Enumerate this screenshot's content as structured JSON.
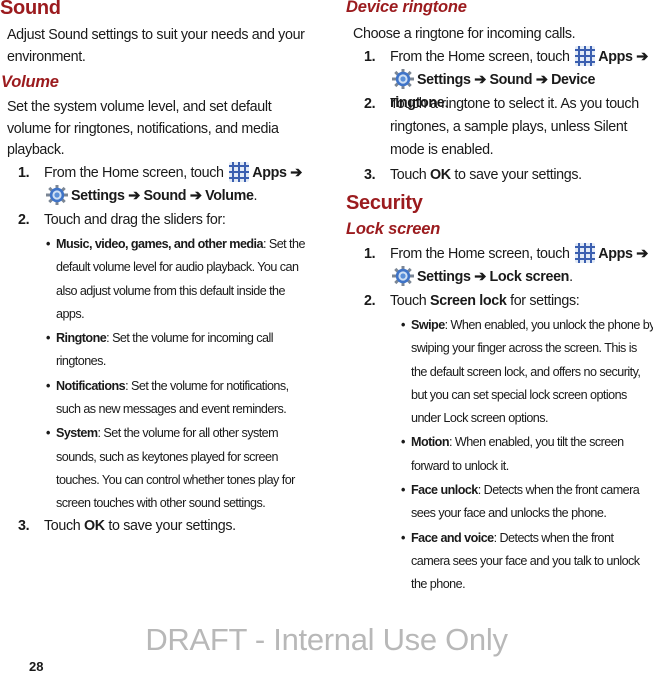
{
  "page_number": "28",
  "watermark": "DRAFT - Internal Use Only",
  "sound": {
    "title": "Sound",
    "intro": "Adjust Sound settings to suit your needs and your environment.",
    "volume": {
      "title": "Volume",
      "intro": "Set the system volume level, and set default volume for ringtones, notifications, and media playback.",
      "steps": [
        {
          "num": "1.",
          "pre": "From the Home screen, touch",
          "apps": "Apps",
          "arrow": "➔",
          "settings": "Settings ➔ Sound ➔ Volume",
          "end": "."
        },
        {
          "num": "2.",
          "text": "Touch and drag the sliders for:"
        },
        {
          "num": "3.",
          "pre": "Touch",
          "bold": "OK",
          "post": "to save your settings."
        }
      ],
      "bullets": [
        {
          "term": "Music, video, games, and other media",
          "desc": ": Set the default volume level for audio playback. You can also adjust volume from this default inside the apps."
        },
        {
          "term": "Ringtone",
          "desc": ": Set the volume for incoming call ringtones."
        },
        {
          "term": "Notifications",
          "desc": ": Set the volume for notifications, such as new messages and event reminders."
        },
        {
          "term": "System",
          "desc": ": Set the volume for all other system sounds, such as keytones played for screen touches. You can control whether tones play for screen touches with other sound settings."
        }
      ]
    },
    "device_ringtone": {
      "title": "Device ringtone",
      "intro": "Choose a ringtone for incoming calls.",
      "steps": [
        {
          "num": "1.",
          "pre": "From the Home screen, touch",
          "apps": "Apps",
          "arrow": "➔",
          "settings": "Settings ➔ Sound ➔ Device ringtone",
          "end": "."
        },
        {
          "num": "2.",
          "text": "Touch a ringtone to select it. As you touch ringtones, a sample plays, unless Silent mode is enabled."
        },
        {
          "num": "3.",
          "pre": "Touch",
          "bold": "OK",
          "post": "to save your settings."
        }
      ]
    }
  },
  "security": {
    "title": "Security",
    "lock_screen": {
      "title": "Lock screen",
      "steps": [
        {
          "num": "1.",
          "pre": "From the Home screen, touch",
          "apps": "Apps",
          "arrow": "➔",
          "settings": "Settings ➔ Lock screen",
          "end": "."
        },
        {
          "num": "2.",
          "pre": "Touch",
          "bold": "Screen lock",
          "post": "for settings:"
        }
      ],
      "bullets": [
        {
          "term": "Swipe",
          "desc": ": When enabled, you unlock the phone by swiping your finger across the screen. This is the default screen lock, and offers no security, but you can set special lock screen options under Lock screen options."
        },
        {
          "term": "Motion",
          "desc": ": When enabled, you tilt the screen forward to unlock it."
        },
        {
          "term": "Face unlock",
          "desc": ": Detects when the front camera sees your face and unlocks the phone."
        },
        {
          "term": "Face and voice",
          "desc": ": Detects when the front camera sees your face and you talk to unlock the phone."
        }
      ]
    }
  },
  "bullet_glyph": "•"
}
